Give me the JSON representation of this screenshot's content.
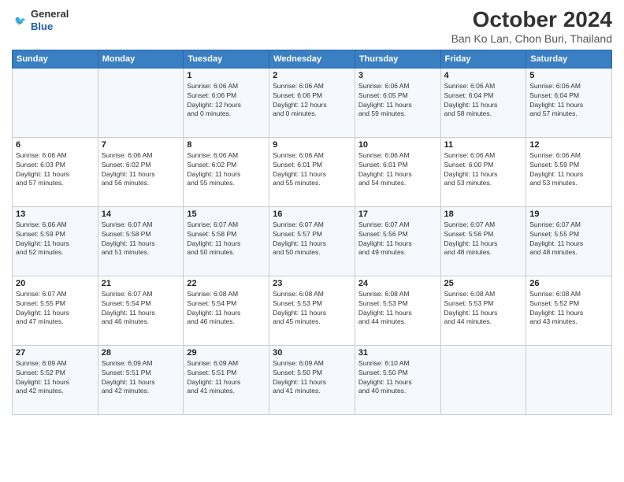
{
  "header": {
    "logo_general": "General",
    "logo_blue": "Blue",
    "title": "October 2024",
    "subtitle": "Ban Ko Lan, Chon Buri, Thailand"
  },
  "days_of_week": [
    "Sunday",
    "Monday",
    "Tuesday",
    "Wednesday",
    "Thursday",
    "Friday",
    "Saturday"
  ],
  "weeks": [
    [
      {
        "day": "",
        "info": ""
      },
      {
        "day": "",
        "info": ""
      },
      {
        "day": "1",
        "info": "Sunrise: 6:06 AM\nSunset: 6:06 PM\nDaylight: 12 hours\nand 0 minutes."
      },
      {
        "day": "2",
        "info": "Sunrise: 6:06 AM\nSunset: 6:06 PM\nDaylight: 12 hours\nand 0 minutes."
      },
      {
        "day": "3",
        "info": "Sunrise: 6:06 AM\nSunset: 6:05 PM\nDaylight: 11 hours\nand 59 minutes."
      },
      {
        "day": "4",
        "info": "Sunrise: 6:06 AM\nSunset: 6:04 PM\nDaylight: 11 hours\nand 58 minutes."
      },
      {
        "day": "5",
        "info": "Sunrise: 6:06 AM\nSunset: 6:04 PM\nDaylight: 11 hours\nand 57 minutes."
      }
    ],
    [
      {
        "day": "6",
        "info": "Sunrise: 6:06 AM\nSunset: 6:03 PM\nDaylight: 11 hours\nand 57 minutes."
      },
      {
        "day": "7",
        "info": "Sunrise: 6:06 AM\nSunset: 6:02 PM\nDaylight: 11 hours\nand 56 minutes."
      },
      {
        "day": "8",
        "info": "Sunrise: 6:06 AM\nSunset: 6:02 PM\nDaylight: 11 hours\nand 55 minutes."
      },
      {
        "day": "9",
        "info": "Sunrise: 6:06 AM\nSunset: 6:01 PM\nDaylight: 11 hours\nand 55 minutes."
      },
      {
        "day": "10",
        "info": "Sunrise: 6:06 AM\nSunset: 6:01 PM\nDaylight: 11 hours\nand 54 minutes."
      },
      {
        "day": "11",
        "info": "Sunrise: 6:06 AM\nSunset: 6:00 PM\nDaylight: 11 hours\nand 53 minutes."
      },
      {
        "day": "12",
        "info": "Sunrise: 6:06 AM\nSunset: 5:59 PM\nDaylight: 11 hours\nand 53 minutes."
      }
    ],
    [
      {
        "day": "13",
        "info": "Sunrise: 6:06 AM\nSunset: 5:59 PM\nDaylight: 11 hours\nand 52 minutes."
      },
      {
        "day": "14",
        "info": "Sunrise: 6:07 AM\nSunset: 5:58 PM\nDaylight: 11 hours\nand 51 minutes."
      },
      {
        "day": "15",
        "info": "Sunrise: 6:07 AM\nSunset: 5:58 PM\nDaylight: 11 hours\nand 50 minutes."
      },
      {
        "day": "16",
        "info": "Sunrise: 6:07 AM\nSunset: 5:57 PM\nDaylight: 11 hours\nand 50 minutes."
      },
      {
        "day": "17",
        "info": "Sunrise: 6:07 AM\nSunset: 5:56 PM\nDaylight: 11 hours\nand 49 minutes."
      },
      {
        "day": "18",
        "info": "Sunrise: 6:07 AM\nSunset: 5:56 PM\nDaylight: 11 hours\nand 48 minutes."
      },
      {
        "day": "19",
        "info": "Sunrise: 6:07 AM\nSunset: 5:55 PM\nDaylight: 11 hours\nand 48 minutes."
      }
    ],
    [
      {
        "day": "20",
        "info": "Sunrise: 6:07 AM\nSunset: 5:55 PM\nDaylight: 11 hours\nand 47 minutes."
      },
      {
        "day": "21",
        "info": "Sunrise: 6:07 AM\nSunset: 5:54 PM\nDaylight: 11 hours\nand 46 minutes."
      },
      {
        "day": "22",
        "info": "Sunrise: 6:08 AM\nSunset: 5:54 PM\nDaylight: 11 hours\nand 46 minutes."
      },
      {
        "day": "23",
        "info": "Sunrise: 6:08 AM\nSunset: 5:53 PM\nDaylight: 11 hours\nand 45 minutes."
      },
      {
        "day": "24",
        "info": "Sunrise: 6:08 AM\nSunset: 5:53 PM\nDaylight: 11 hours\nand 44 minutes."
      },
      {
        "day": "25",
        "info": "Sunrise: 6:08 AM\nSunset: 5:53 PM\nDaylight: 11 hours\nand 44 minutes."
      },
      {
        "day": "26",
        "info": "Sunrise: 6:08 AM\nSunset: 5:52 PM\nDaylight: 11 hours\nand 43 minutes."
      }
    ],
    [
      {
        "day": "27",
        "info": "Sunrise: 6:09 AM\nSunset: 5:52 PM\nDaylight: 11 hours\nand 42 minutes."
      },
      {
        "day": "28",
        "info": "Sunrise: 6:09 AM\nSunset: 5:51 PM\nDaylight: 11 hours\nand 42 minutes."
      },
      {
        "day": "29",
        "info": "Sunrise: 6:09 AM\nSunset: 5:51 PM\nDaylight: 11 hours\nand 41 minutes."
      },
      {
        "day": "30",
        "info": "Sunrise: 6:09 AM\nSunset: 5:50 PM\nDaylight: 11 hours\nand 41 minutes."
      },
      {
        "day": "31",
        "info": "Sunrise: 6:10 AM\nSunset: 5:50 PM\nDaylight: 11 hours\nand 40 minutes."
      },
      {
        "day": "",
        "info": ""
      },
      {
        "day": "",
        "info": ""
      }
    ]
  ]
}
